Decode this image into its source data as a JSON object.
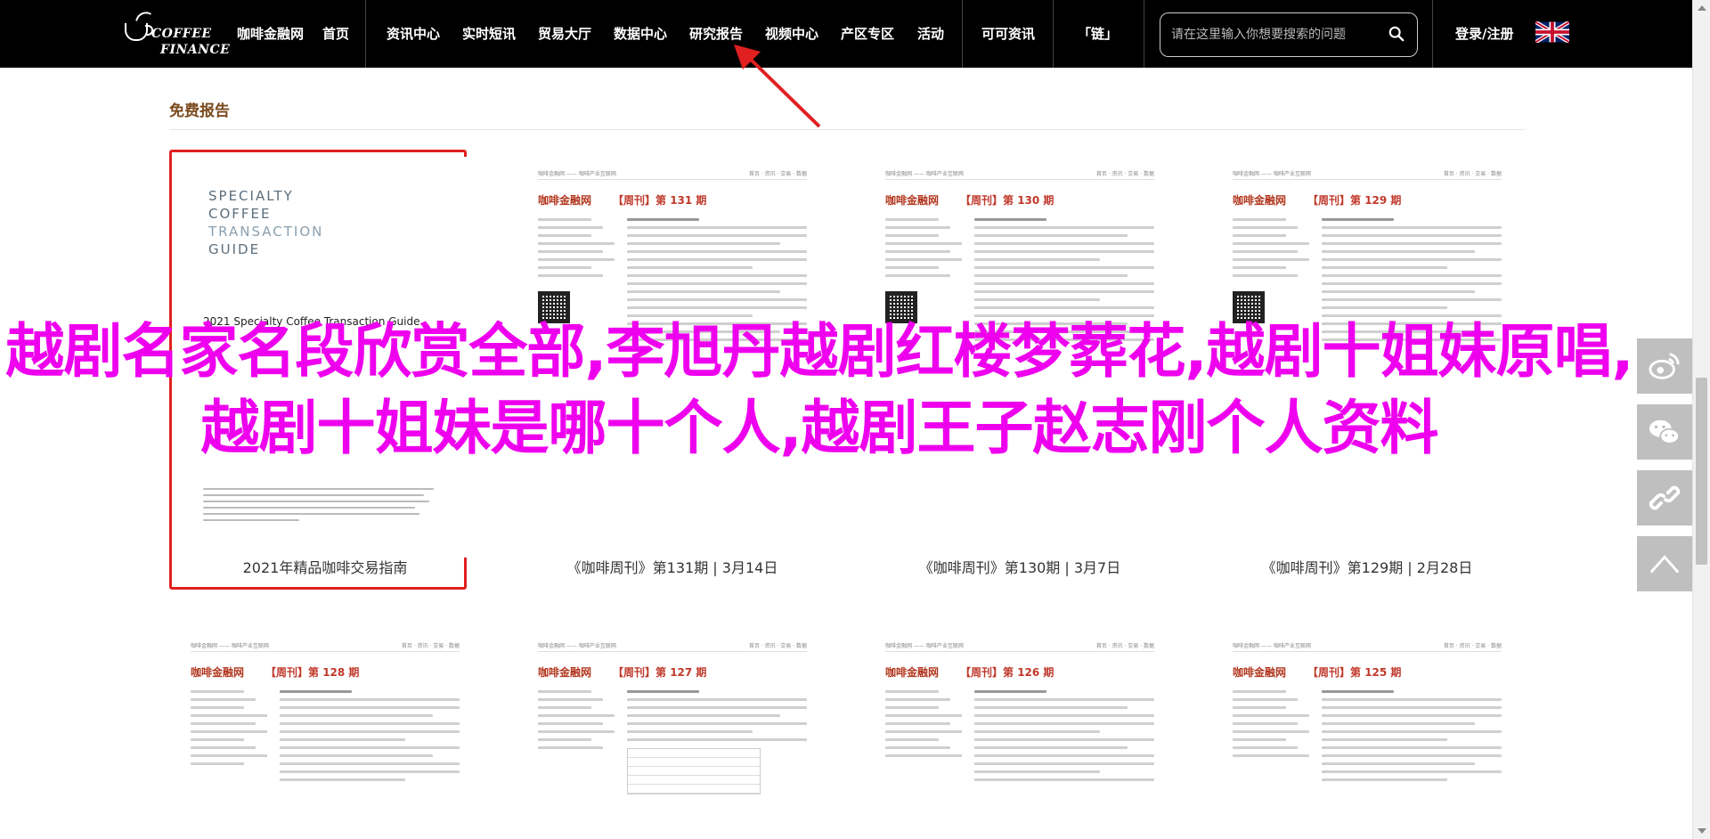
{
  "nav": {
    "logo_line1": "COFFEE",
    "logo_line2": "FINANCE",
    "items": [
      {
        "label": "咖啡金融网"
      },
      {
        "label": "首页"
      },
      {
        "label": "资讯中心"
      },
      {
        "label": "实时短讯"
      },
      {
        "label": "贸易大厅"
      },
      {
        "label": "数据中心"
      },
      {
        "label": "研究报告"
      },
      {
        "label": "视频中心"
      },
      {
        "label": "产区专区"
      },
      {
        "label": "活动"
      },
      {
        "label": "可可资讯"
      },
      {
        "label": "「链」"
      }
    ],
    "search_placeholder": "请在这里输入你想要搜索的问题",
    "login_label": "登录/注册"
  },
  "section": {
    "title": "免费报告"
  },
  "reports_row1": [
    {
      "caption": "2021年精品咖啡交易指南",
      "cover_title_line1": "SPECIALTY",
      "cover_title_line2": "COFFEE",
      "cover_title_line3": "TRANSACTION",
      "cover_title_line4": "GUIDE",
      "cover_subtitle": "2021 Specialty Coffee Transaction Guide"
    },
    {
      "caption": "《咖啡周刊》第131期 | 3月14日",
      "brand": "咖啡金融网",
      "issue": "【周刊】第 131 期"
    },
    {
      "caption": "《咖啡周刊》第130期 | 3月7日",
      "brand": "咖啡金融网",
      "issue": "【周刊】第 130 期"
    },
    {
      "caption": "《咖啡周刊》第129期 | 2月28日",
      "brand": "咖啡金融网",
      "issue": "【周刊】第 129 期"
    }
  ],
  "reports_row2": [
    {
      "brand": "咖啡金融网",
      "issue": "【周刊】第 128 期"
    },
    {
      "brand": "咖啡金融网",
      "issue": "【周刊】第 127 期"
    },
    {
      "brand": "咖啡金融网",
      "issue": "【周刊】第 126 期"
    },
    {
      "brand": "咖啡金融网",
      "issue": "【周刊】第 125 期"
    }
  ],
  "headline": "越剧名家名段欣赏全部,李旭丹越剧红楼梦葬花,越剧十姐妹原唱,越剧十姐妹是哪十个人,越剧王子赵志刚个人资料",
  "colors": {
    "headline": "#ee00ee",
    "section_title": "#7a4a1e",
    "highlight_border": "#e02020",
    "arrow": "#e02020"
  },
  "icons": [
    "search-icon",
    "uk-flag-icon",
    "weibo-icon",
    "wechat-icon",
    "link-icon",
    "back-to-top-icon"
  ]
}
